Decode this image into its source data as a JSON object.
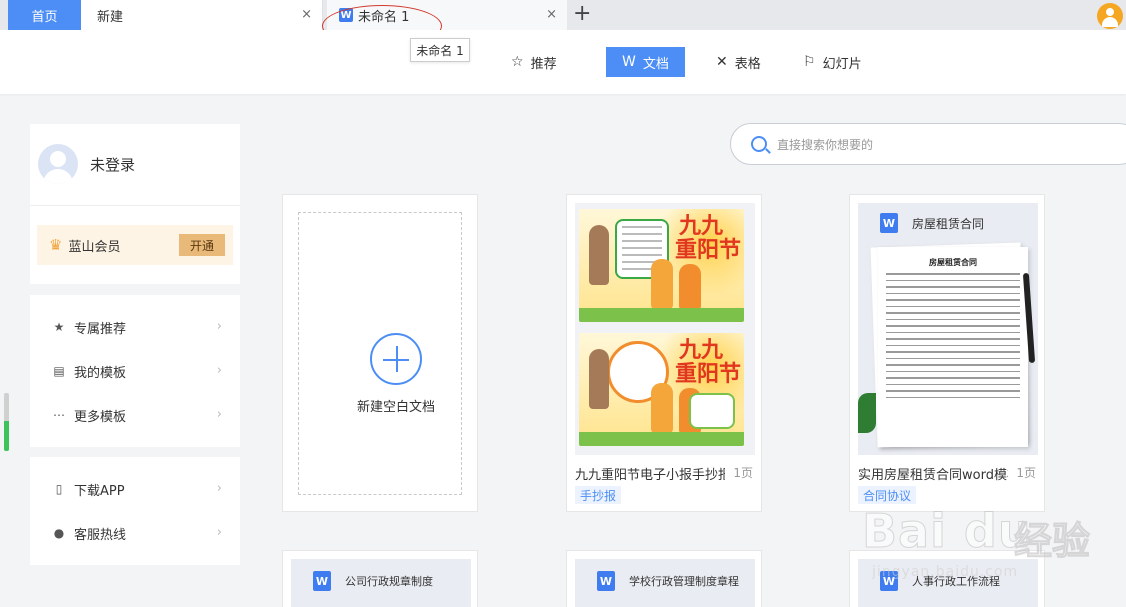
{
  "tabs": {
    "home": "首页",
    "new": "新建",
    "doc": "未命名 1",
    "doc_badge": "W",
    "close_glyph": "×",
    "add_glyph": "+",
    "tooltip": "未命名 1"
  },
  "nav": {
    "recommend": "推荐",
    "document": "文档",
    "sheet": "表格",
    "slides": "幻灯片",
    "document_badge": "W"
  },
  "sidebar": {
    "username": "未登录",
    "member_label": "蓝山会员",
    "member_button": "开通",
    "menu": [
      {
        "label": "专属推荐",
        "icon": "star-icon"
      },
      {
        "label": "我的模板",
        "icon": "template-icon"
      },
      {
        "label": "更多模板",
        "icon": "more-icon"
      }
    ],
    "menu2": [
      {
        "label": "下载APP",
        "icon": "phone-icon"
      },
      {
        "label": "客服热线",
        "icon": "service-icon"
      }
    ]
  },
  "search": {
    "placeholder": "直接搜索你想要的"
  },
  "new_doc": {
    "label": "新建空白文档"
  },
  "templates": [
    {
      "title": "九九重阳节电子小报手抄报",
      "pages": "1页",
      "tag": "手抄报",
      "poster_title_1": "九九",
      "poster_title_2": "重阳节"
    },
    {
      "title": "实用房屋租赁合同word模板",
      "pages": "1页",
      "tag": "合同协议",
      "doc_head": "房屋租赁合同",
      "paper_title": "房屋租赁合同"
    }
  ],
  "bottom_templates": [
    {
      "doc_head": "公司行政规章制度"
    },
    {
      "doc_head": "学校行政管理制度章程"
    },
    {
      "doc_head": "人事行政工作流程"
    }
  ],
  "watermark": {
    "brand": "Bai du",
    "cn": "经验",
    "url": "jingyan.baidu.com"
  },
  "colors": {
    "accent": "#4c8ef5",
    "member_bg": "#fdf4e5",
    "member_button": "#e9b97a",
    "tag_text": "#4c8ef5",
    "annotation": "#d23a2e"
  }
}
